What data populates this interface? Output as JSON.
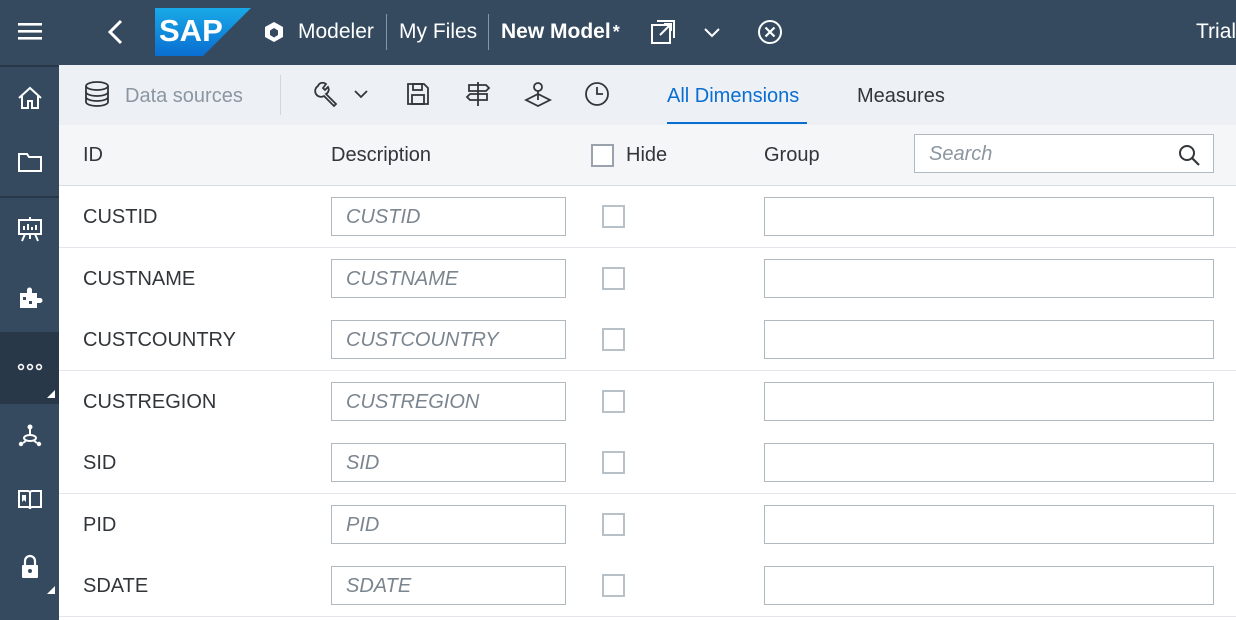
{
  "shell": {
    "app_name": "Modeler",
    "breadcrumb_files": "My Files",
    "model_title": "New Model",
    "unsaved_marker": "*",
    "trial_label": "Trial",
    "logo_text": "SAP",
    "brand_color": "#0a6ed1",
    "header_bg": "#354a5f"
  },
  "rail": {
    "items": [
      {
        "icon": "home-icon"
      },
      {
        "icon": "folder-icon"
      },
      {
        "icon": "presentation-icon"
      },
      {
        "icon": "modeler-puzzle-icon"
      },
      {
        "icon": "more-icon",
        "active": true
      },
      {
        "icon": "connections-icon"
      },
      {
        "icon": "learning-book-icon"
      },
      {
        "icon": "lock-icon"
      }
    ]
  },
  "toolbar": {
    "data_sources_label": "Data sources",
    "tools_icons": [
      "wrench-icon",
      "save-icon",
      "signpost-icon",
      "geo-map-icon",
      "history-clock-icon"
    ],
    "tabs": [
      {
        "label": "All Dimensions",
        "selected": true
      },
      {
        "label": "Measures",
        "selected": false
      }
    ]
  },
  "grid": {
    "columns": {
      "id": "ID",
      "description": "Description",
      "hide": "Hide",
      "group": "Group"
    },
    "search_placeholder": "Search",
    "rows": [
      {
        "id": "CUSTID",
        "description_placeholder": "CUSTID",
        "group": ""
      },
      {
        "id": "CUSTNAME",
        "description_placeholder": "CUSTNAME",
        "group": ""
      },
      {
        "id": "CUSTCOUNTRY",
        "description_placeholder": "CUSTCOUNTRY",
        "group": ""
      },
      {
        "id": "CUSTREGION",
        "description_placeholder": "CUSTREGION",
        "group": ""
      },
      {
        "id": "SID",
        "description_placeholder": "SID",
        "group": ""
      },
      {
        "id": "PID",
        "description_placeholder": "PID",
        "group": ""
      },
      {
        "id": "SDATE",
        "description_placeholder": "SDATE",
        "group": ""
      }
    ]
  }
}
